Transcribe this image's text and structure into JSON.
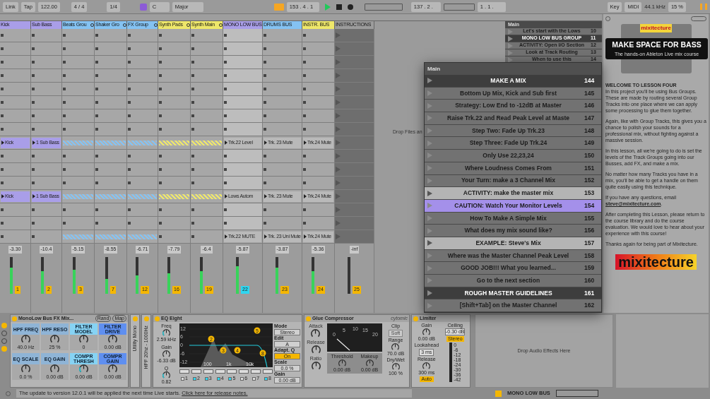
{
  "toolbar": {
    "link": "Link",
    "tap": "Tap",
    "tempo": "122.00",
    "signature": "4 / 4",
    "quantize": "1/4",
    "scale_root": "C",
    "scale_mode": "Major",
    "position": "153 . 4 . 1",
    "playing": true,
    "loop_start": "137 . 2 .",
    "loop_length": "1 . 1 .",
    "key": "Key",
    "midi": "MIDI",
    "sample_rate": "44.1 kHz",
    "cpu": "15 %"
  },
  "tracks": [
    {
      "name": "Kick",
      "color": "#a99ee8",
      "group": false,
      "number": "1",
      "volume": "-3.30",
      "level": 0.7,
      "selected": false
    },
    {
      "name": "Sub Bass",
      "color": "#a99ee8",
      "group": false,
      "number": "2",
      "volume": "-10.4",
      "level": 0.6,
      "selected": false
    },
    {
      "name": "Beats Grou",
      "color": "#84c2f2",
      "group": true,
      "number": "3",
      "volume": "-5.15",
      "level": 0.65,
      "selected": false
    },
    {
      "name": "Shaker Gro",
      "color": "#84c2f2",
      "group": true,
      "number": "7",
      "volume": "-8.55",
      "level": 0.4,
      "selected": false
    },
    {
      "name": "FX Group",
      "color": "#84c2f2",
      "group": true,
      "number": "12",
      "volume": "-6.71",
      "level": 0.5,
      "selected": false
    },
    {
      "name": "Synth Pads",
      "color": "#eee76a",
      "group": true,
      "number": "16",
      "volume": "-7.79",
      "level": 0.55,
      "selected": false
    },
    {
      "name": "Synth Main",
      "color": "#eee76a",
      "group": true,
      "number": "19",
      "volume": "-6.4",
      "level": 0.6,
      "selected": false
    },
    {
      "name": "MONO LOW BUS",
      "color": "#a99ee8",
      "group": false,
      "number": "22",
      "volume": "-5.87",
      "level": 0.75,
      "selected": true
    },
    {
      "name": "DRUMS BUS",
      "color": "#84c2f2",
      "group": false,
      "number": "23",
      "volume": "-3.87",
      "level": 0.7,
      "selected": false
    },
    {
      "name": "INSTR. BUS",
      "color": "#eee76a",
      "group": false,
      "number": "24",
      "volume": "-5.36",
      "level": 0.6,
      "selected": false
    },
    {
      "name": "INSTRUCTIONS",
      "color": "#9c9c9c",
      "group": false,
      "number": "25",
      "volume": "-inf",
      "selected": false
    }
  ],
  "scenes": [
    {
      "kind": "empty"
    },
    {
      "kind": "empty"
    },
    {
      "kind": "empty"
    },
    {
      "kind": "empty"
    },
    {
      "kind": "empty"
    },
    {
      "kind": "empty"
    },
    {
      "kind": "empty"
    },
    {
      "kind": "empty"
    },
    {
      "kind": "clips",
      "cells": [
        {
          "kind": "clip",
          "name": "Kick"
        },
        {
          "kind": "clip",
          "name": "1 Sub Bass"
        },
        {
          "kind": "group"
        },
        {
          "kind": "group"
        },
        {
          "kind": "group"
        },
        {
          "kind": "group"
        },
        {
          "kind": "group"
        },
        {
          "kind": "clip",
          "name": "Trk.22 Level"
        },
        {
          "kind": "clip",
          "name": "Trk. 23 Mute"
        },
        {
          "kind": "clip",
          "name": "Trk.24 Mute"
        },
        {
          "kind": "empty"
        }
      ]
    },
    {
      "kind": "empty"
    },
    {
      "kind": "empty"
    },
    {
      "kind": "empty"
    },
    {
      "kind": "clips",
      "cells": [
        {
          "kind": "clip",
          "name": "Kick"
        },
        {
          "kind": "clip",
          "name": "1 Sub Bass"
        },
        {
          "kind": "group"
        },
        {
          "kind": "group"
        },
        {
          "kind": "group"
        },
        {
          "kind": "group"
        },
        {
          "kind": "group"
        },
        {
          "kind": "clip",
          "name": "Lows Autom"
        },
        {
          "kind": "clip",
          "name": "Trk. 23 Mute"
        },
        {
          "kind": "clip",
          "name": "Trk.24 Mute"
        },
        {
          "kind": "empty"
        }
      ]
    },
    {
      "kind": "empty"
    },
    {
      "kind": "empty"
    },
    {
      "kind": "clips",
      "cells": [
        {
          "kind": "empty"
        },
        {
          "kind": "empty"
        },
        {
          "kind": "group"
        },
        {
          "kind": "group"
        },
        {
          "kind": "group"
        },
        {
          "kind": "empty"
        },
        {
          "kind": "empty"
        },
        {
          "kind": "clip",
          "name": "Trk.22 MUTE"
        },
        {
          "kind": "clip",
          "name": "Trk. 23 Uni Mute"
        },
        {
          "kind": "clip",
          "name": "Trk.24 Mute"
        },
        {
          "kind": "empty"
        }
      ]
    }
  ],
  "drop_files": "Drop Files an",
  "back_list": {
    "title": "Main",
    "items": [
      {
        "kind": "item",
        "text": "Let's start with the Lows",
        "number": "10"
      },
      {
        "kind": "header",
        "text": "MONO LOW BUS GROUP",
        "number": "11"
      },
      {
        "kind": "item",
        "text": "ACTIVITY: Open I/O Section",
        "number": "12"
      },
      {
        "kind": "item",
        "text": "Look at Track Routing",
        "number": "13"
      },
      {
        "kind": "item",
        "text": "When to use this",
        "number": "14"
      }
    ]
  },
  "popup": {
    "title": "Main",
    "items": [
      {
        "kind": "header",
        "text": "MAKE A MIX",
        "number": "144",
        "selected": false
      },
      {
        "kind": "item",
        "text": "Bottom Up Mix, Kick and Sub first",
        "number": "145",
        "selected": false
      },
      {
        "kind": "item",
        "text": "Strategy: Low End to -12dB at Master",
        "number": "146",
        "selected": false
      },
      {
        "kind": "item",
        "text": "Raise Trk.22 and Read Peak Level at Maste",
        "number": "147",
        "selected": false
      },
      {
        "kind": "item",
        "text": "Step Two: Fade Up Trk.23",
        "number": "148",
        "selected": false
      },
      {
        "kind": "item",
        "text": "Step Three: Fade Up Trk.24",
        "number": "149",
        "selected": false
      },
      {
        "kind": "item",
        "text": "Only Use 22,23,24",
        "number": "150",
        "selected": false
      },
      {
        "kind": "item",
        "text": "Where Loudness Comes From",
        "number": "151",
        "selected": false
      },
      {
        "kind": "item",
        "text": "Your Turn: make a 3 Channel Mix",
        "number": "152",
        "selected": false
      },
      {
        "kind": "light",
        "text": "ACTIVITY: make the master mix",
        "number": "153",
        "selected": false
      },
      {
        "kind": "item",
        "text": "CAUTION: Watch Your Monitor Levels",
        "number": "154",
        "selected": true
      },
      {
        "kind": "item",
        "text": "How To Make A Simple Mix",
        "number": "155",
        "selected": false
      },
      {
        "kind": "item",
        "text": "What does my mix sound like?",
        "number": "156",
        "selected": false
      },
      {
        "kind": "light",
        "text": "EXAMPLE: Steve's Mix",
        "number": "157",
        "selected": false
      },
      {
        "kind": "item",
        "text": "Where was the Master Channel Peak Level",
        "number": "158",
        "selected": false
      },
      {
        "kind": "item",
        "text": "GOOD JOB!!! What you learned...",
        "number": "159",
        "selected": false
      },
      {
        "kind": "item",
        "text": "Go to the next section",
        "number": "160",
        "selected": false
      },
      {
        "kind": "header",
        "text": "ROUGH MASTER GUIDELINES",
        "number": "161",
        "selected": false
      },
      {
        "kind": "item",
        "text": "[Shift+Tab] on the Master Channel",
        "number": "162",
        "selected": false
      }
    ]
  },
  "info": {
    "logo": "mixitecture",
    "banner_title": "MAKE SPACE FOR BASS",
    "banner_subtitle": "The hands-on Ableton Live mix course",
    "paragraphs": [
      {
        "kind": "heading",
        "text": "WELCOME TO LESSON FOUR"
      },
      {
        "kind": "text",
        "text": "In this project you'll be using Bus Groups. These are made by routing several Group Tracks into one place where we can apply some processing to glue them together."
      },
      {
        "kind": "text",
        "text": "Again, like with Group Tracks, this gives you a chance to polish your sounds for a professional mix, without fighting against a massive session."
      },
      {
        "kind": "text",
        "text": "In this lesson, all we're going to do is set the levels of the Track Groups going into our Busses, add FX, and make a mix."
      },
      {
        "kind": "text",
        "text": "No matter how many Tracks you have in a mix, you'll be able to get a handle on them quite easily using this technique."
      },
      {
        "kind": "email",
        "text": "If you have any questions, email",
        "link": "steve@mixitecture.com",
        "after": "."
      },
      {
        "kind": "text",
        "text": "After completing this Lesson, please return to the course library and do the course evaluation.  We would love to hear about your experience with this course!"
      },
      {
        "kind": "text",
        "text": "Thanks again for being part of Mixitecture."
      }
    ],
    "footer_logo": "mixitecture"
  },
  "rack": {
    "title": "MonoLow Bus FX Mix...",
    "buttons": [
      "Rand",
      "Map"
    ],
    "macros": [
      {
        "label": "HPF FREQ",
        "value": "40.0 Hz",
        "color": "#8fb4d6"
      },
      {
        "label": "HPF RESO",
        "value": "25 %",
        "color": "#8fb4d6"
      },
      {
        "label": "FILTER MODEL",
        "value": "0",
        "color": "#86d3f4"
      },
      {
        "label": "FILTER DRIVE",
        "value": "0.00 dB",
        "color": "#5f8ff0"
      },
      {
        "label": "EQ SCALE",
        "value": "0.0 %",
        "color": "#8fb4d6"
      },
      {
        "label": "EQ GAIN",
        "value": "0.00 dB",
        "color": "#8fb4d6"
      },
      {
        "label": "COMPR THRESH",
        "value": "0.00 dB",
        "color": "#86d3f4"
      },
      {
        "label": "COMPR GAIN",
        "value": "0.00 dB",
        "color": "#5f8ff0"
      }
    ]
  },
  "utility_strips": [
    "Utility Mono",
    "HPF 20hz - 1000Hz"
  ],
  "eq": {
    "title": "EQ Eight",
    "params": [
      {
        "label": "Freq",
        "value": "2.59 kHz"
      },
      {
        "label": "Gain",
        "value": "-6.33 dB"
      },
      {
        "label": "Q",
        "value": "0.82"
      }
    ],
    "y_labels": [
      "12",
      "6",
      "0",
      "-6",
      "-12"
    ],
    "x_labels": [
      "100",
      "1k",
      "10k"
    ],
    "bands": [
      {
        "number": "1",
        "on": false
      },
      {
        "number": "2",
        "on": true,
        "marker": "2"
      },
      {
        "number": "3",
        "on": true,
        "marker": "3"
      },
      {
        "number": "4",
        "on": true,
        "marker": "4"
      },
      {
        "number": "5",
        "on": true,
        "marker": "5"
      },
      {
        "number": "6",
        "on": false
      },
      {
        "number": "7",
        "on": false
      },
      {
        "number": "8",
        "on": true,
        "marker": "8"
      }
    ],
    "side": [
      {
        "label": "Mode",
        "value": "Stereo",
        "active": false
      },
      {
        "label": "Edit",
        "value": "A",
        "active": false
      },
      {
        "label": "Adapt. Q",
        "value": "On",
        "active": true
      },
      {
        "label": "Scale",
        "value": "0.0 %",
        "active": false
      },
      {
        "label": "Gain",
        "value": "0.00 dB",
        "active": false
      }
    ]
  },
  "glue": {
    "title": "Glue Compressor",
    "brand": "cytomic",
    "left": [
      "Attack",
      "Release",
      "Ratio"
    ],
    "meter_scale": [
      "0",
      "5",
      "10",
      "15",
      "20"
    ],
    "threshold": {
      "label": "Threshold",
      "value": "0.00 dB"
    },
    "makeup": {
      "label": "Makeup",
      "value": "0.00 dB"
    },
    "clip": {
      "label": "Clip",
      "value": "Soft"
    },
    "range": {
      "label": "Range",
      "value": "70.0 dB"
    },
    "drywet": {
      "label": "Dry/Wet",
      "value": "100 %"
    }
  },
  "limiter": {
    "title": "Limiter",
    "gain": {
      "label": "Gain",
      "value": "0.00 dB"
    },
    "ceiling": {
      "label": "Ceiling",
      "value": "-0.30 dB"
    },
    "stereo": "Stereo",
    "lookahead": {
      "label": "Lookahead",
      "value": "3 ms"
    },
    "release": {
      "label": "Release",
      "value": "300 ms"
    },
    "auto": "Auto",
    "scale": [
      "0",
      "-6",
      "-12",
      "-18",
      "-24",
      "-30",
      "-36",
      "-42"
    ]
  },
  "drop_effects": "Drop Audio Effects Here",
  "status": {
    "message": "The update to version 12.0.1 will be applied the next time Live starts.",
    "link": "Click here for release notes.",
    "track": "MONO LOW BUS"
  }
}
